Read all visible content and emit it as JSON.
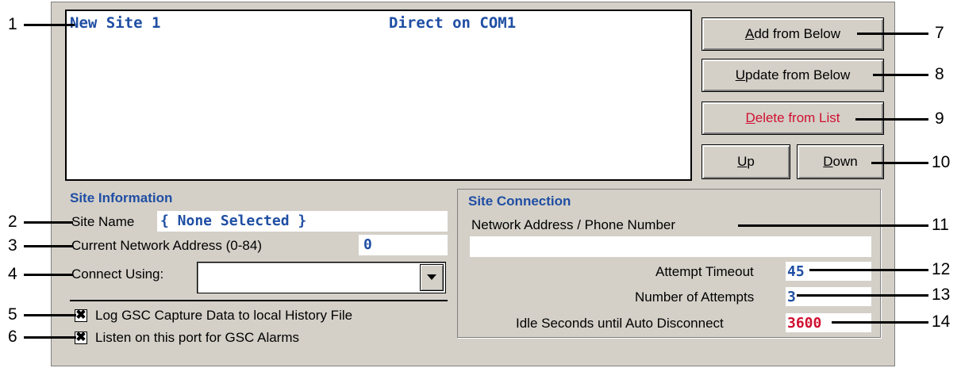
{
  "list": {
    "site_name": "New Site 1",
    "connection": "Direct on COM1"
  },
  "buttons": {
    "add": {
      "prefix": "",
      "mnemonic": "A",
      "rest": "dd from Below"
    },
    "update": {
      "prefix": "",
      "mnemonic": "U",
      "rest": "pdate from Below"
    },
    "delete": {
      "prefix": "",
      "mnemonic": "D",
      "rest": "elete from List"
    },
    "up": {
      "prefix": "",
      "mnemonic": "U",
      "rest": "p"
    },
    "down": {
      "prefix": "",
      "mnemonic": "D",
      "rest": "own"
    }
  },
  "site_info": {
    "title": "Site Information",
    "site_name_label": "Site Name",
    "site_name_value": "{ None Selected }",
    "network_address_label": "Current Network Address (0-84)",
    "network_address_value": "0",
    "connect_using_label": "Connect Using:",
    "connect_using_value": "",
    "log_checkbox_label": "Log GSC Capture Data to local History File",
    "log_checked": "✖",
    "listen_checkbox_label": "Listen on this port for GSC Alarms",
    "listen_checked": "✖"
  },
  "site_connection": {
    "title": "Site Connection",
    "address_label": "Network Address / Phone Number",
    "address_value": "",
    "timeout_label": "Attempt Timeout",
    "timeout_value": "45",
    "attempts_label": "Number of Attempts",
    "attempts_value": "3",
    "idle_label": "Idle Seconds until Auto Disconnect",
    "idle_value": "3600"
  },
  "callouts": [
    "1",
    "2",
    "3",
    "4",
    "5",
    "6",
    "7",
    "8",
    "9",
    "10",
    "11",
    "12",
    "13",
    "14"
  ],
  "colors": {
    "accent_blue": "#1f4ea3",
    "accent_red": "#d01030",
    "panel": "#d4d0c8"
  }
}
